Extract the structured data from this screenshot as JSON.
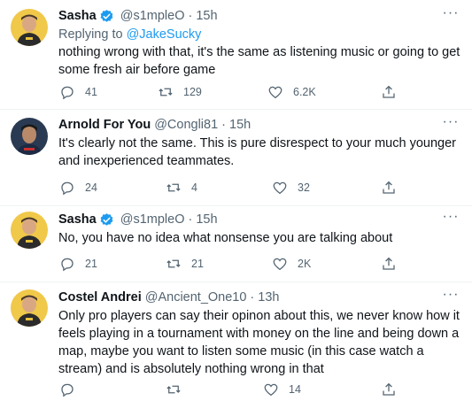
{
  "tweets": [
    {
      "name": "Sasha",
      "verified": true,
      "handle": "@s1mpleO",
      "time": "15h",
      "replying_label": "Replying to",
      "replying_to": "@JakeSucky",
      "text": "nothing wrong with that, it's the same as listening music or going to get some fresh air before game",
      "replies": "41",
      "retweets": "129",
      "likes": "6.2K",
      "avatar_colors": {
        "bg": "#f0c84a",
        "hair": "#4a3a2a",
        "skin": "#d9a883",
        "shirt": "#2b2b2b"
      }
    },
    {
      "name": "Arnold For You",
      "verified": false,
      "handle": "@Congli81",
      "time": "15h",
      "text": "It's clearly not the same. This is pure disrespect to your much younger and inexperienced teammates.",
      "replies": "24",
      "retweets": "4",
      "likes": "32",
      "avatar_colors": {
        "bg": "#2a3a52",
        "hair": "#1a1a1a",
        "skin": "#b98a6a",
        "shirt": "#1c2a44"
      }
    },
    {
      "name": "Sasha",
      "verified": true,
      "handle": "@s1mpleO",
      "time": "15h",
      "text": "No, you have no idea what nonsense you are talking about",
      "replies": "21",
      "retweets": "21",
      "likes": "2K",
      "avatar_colors": {
        "bg": "#f0c84a",
        "hair": "#4a3a2a",
        "skin": "#d9a883",
        "shirt": "#2b2b2b"
      }
    },
    {
      "name": "Costel Andrei",
      "verified": false,
      "handle": "@Ancient_One10",
      "time": "13h",
      "text": "Only pro players can say their opinon about this, we never know how it feels playing in a tournament with money on the line and being down a map, maybe you want to listen some music (in this case watch a stream) and is absolutely nothing wrong in that",
      "replies": "",
      "retweets": "",
      "likes": "14",
      "avatar_colors": {
        "bg": "#f0c84a",
        "hair": "#4a3a2a",
        "skin": "#d9a883",
        "shirt": "#2b2b2b"
      }
    }
  ],
  "colors": {
    "link": "#1d9bf0",
    "muted": "#536471",
    "verified": "#1d9bf0"
  }
}
